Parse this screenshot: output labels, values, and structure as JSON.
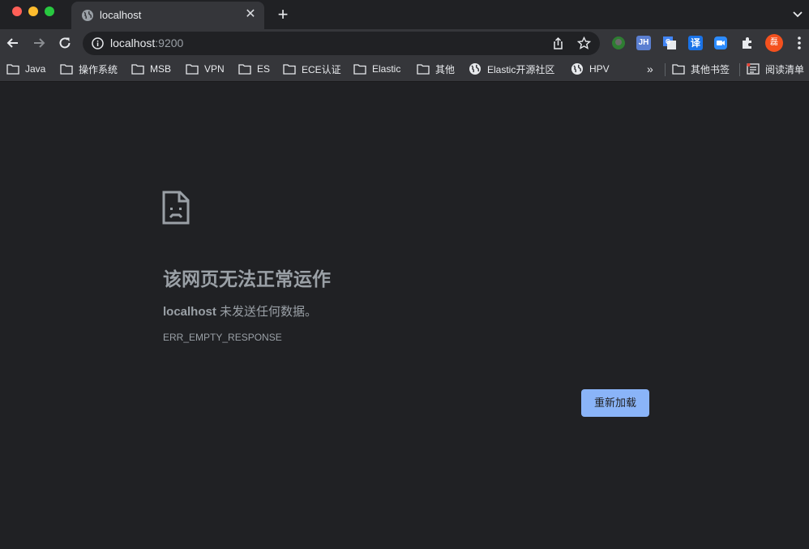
{
  "tab": {
    "title": "localhost",
    "close": "✕",
    "new_tab": "+"
  },
  "omnibox": {
    "host": "localhost",
    "port": ":9200"
  },
  "extensions": {
    "jh": "JH",
    "translate": "译",
    "profile_initial": "磊"
  },
  "bookmarks": {
    "items": [
      {
        "label": "Java",
        "icon": "folder-icon"
      },
      {
        "label": "操作系统",
        "icon": "folder-icon"
      },
      {
        "label": "MSB",
        "icon": "folder-icon"
      },
      {
        "label": "VPN",
        "icon": "folder-icon"
      },
      {
        "label": "ES",
        "icon": "folder-icon"
      },
      {
        "label": "ECE认证",
        "icon": "folder-icon"
      },
      {
        "label": "Elastic",
        "icon": "folder-icon"
      },
      {
        "label": "其他",
        "icon": "folder-icon"
      },
      {
        "label": "Elastic开源社区",
        "icon": "globe-icon"
      },
      {
        "label": "HPV",
        "icon": "globe-icon"
      }
    ],
    "overflow": "»",
    "other_bookmarks": "其他书签",
    "reading_list": "阅读清单"
  },
  "error": {
    "title": "该网页无法正常运作",
    "host": "localhost",
    "message": " 未发送任何数据。",
    "code": "ERR_EMPTY_RESPONSE",
    "reload_label": "重新加载"
  },
  "colors": {
    "background": "#202124",
    "toolbar": "#35363a",
    "accent": "#8ab4f8",
    "avatar": "#f4511e"
  }
}
